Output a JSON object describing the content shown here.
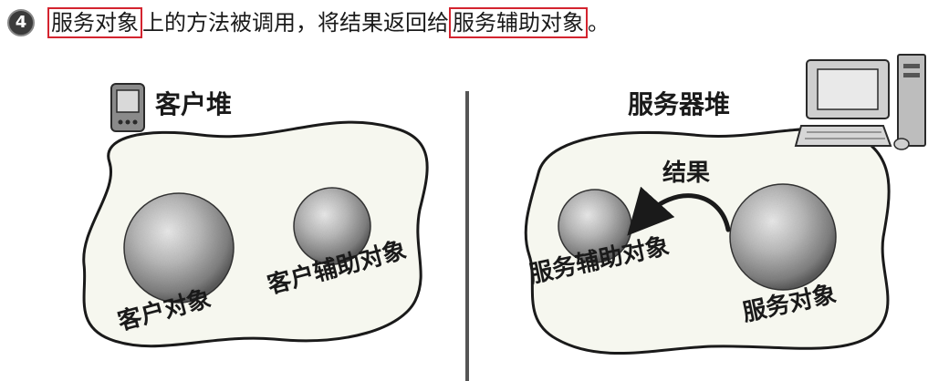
{
  "caption": {
    "step": "4",
    "part1": "服务对象",
    "part2": "上的方法被调用，将结果返回给",
    "part3": "服务辅助对象",
    "part4": "。"
  },
  "client_heap": {
    "title": "客户堆",
    "client_object": "客户对象",
    "client_helper": "客户辅助对象"
  },
  "server_heap": {
    "title": "服务器堆",
    "result": "结果",
    "service_helper": "服务辅助对象",
    "service_object": "服务对象"
  }
}
